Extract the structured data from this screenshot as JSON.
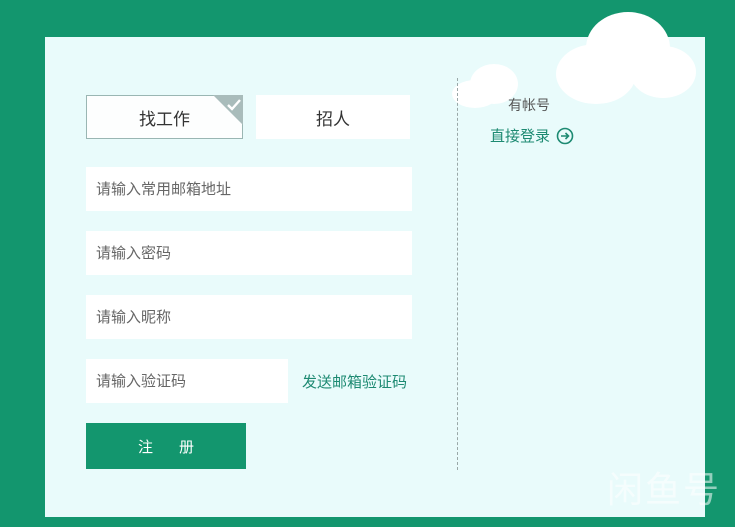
{
  "tabs": {
    "job_label": "找工作",
    "hire_label": "招人"
  },
  "form": {
    "email_placeholder": "请输入常用邮箱地址",
    "password_placeholder": "请输入密码",
    "nickname_placeholder": "请输入昵称",
    "code_placeholder": "请输入验证码",
    "send_code_label": "发送邮箱验证码",
    "register_label": "注册"
  },
  "side": {
    "have_account_text": "有帐号",
    "login_label": "直接登录",
    "login_icon": "arrow-right-circle-icon"
  },
  "watermark": "闲鱼号",
  "colors": {
    "brand_green": "#13966e",
    "card_bg": "#e9fbfb",
    "link_green": "#1d8a72"
  }
}
